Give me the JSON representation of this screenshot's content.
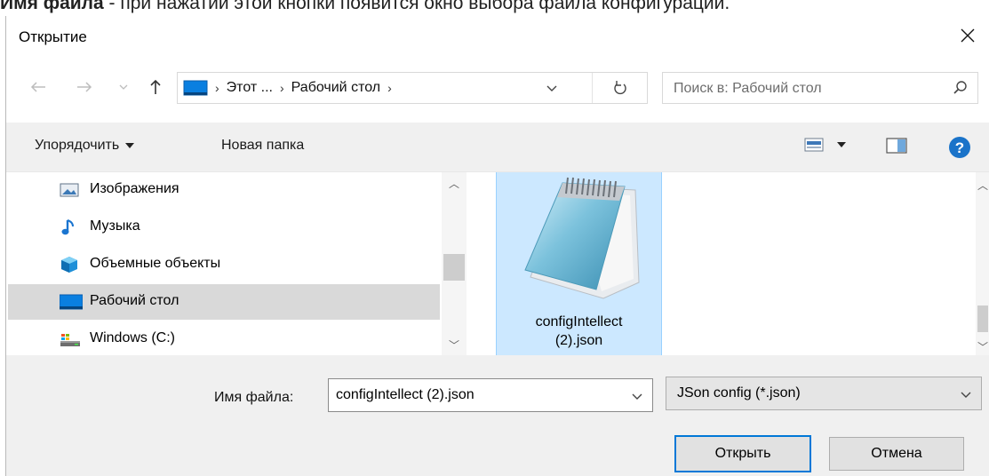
{
  "caption": {
    "bold_text": "Имя файла",
    "rest_text": " - при нажатии этой кнопки появится окно выбора файла конфигурации."
  },
  "window": {
    "title": "Открытие"
  },
  "address_bar": {
    "crumbs": [
      "Этот ...",
      "Рабочий стол"
    ]
  },
  "search": {
    "placeholder": "Поиск в: Рабочий стол"
  },
  "toolbar": {
    "organize_label": "Упорядочить",
    "new_folder_label": "Новая папка"
  },
  "nav": {
    "items": [
      {
        "label": "Изображения",
        "icon": "pictures-icon"
      },
      {
        "label": "Музыка",
        "icon": "music-icon"
      },
      {
        "label": "Объемные объекты",
        "icon": "3d-objects-icon"
      },
      {
        "label": "Рабочий стол",
        "icon": "desktop-icon",
        "selected": true
      },
      {
        "label": "Windows (C:)",
        "icon": "drive-icon"
      }
    ]
  },
  "files": [
    {
      "name_line1": "configIntellect",
      "name_line2": "(2).json",
      "icon": "notepad-icon",
      "selected": true
    }
  ],
  "footer": {
    "filename_label": "Имя файла:",
    "filename_value": "configIntellect (2).json",
    "filter_value": "JSon config (*.json)",
    "open_label": "Открыть",
    "cancel_label": "Отмена"
  },
  "colors": {
    "accent": "#0078d7",
    "selection": "#cce8ff",
    "toolbar_bg": "#f0f0f0",
    "help_blue": "#1a73c9"
  }
}
